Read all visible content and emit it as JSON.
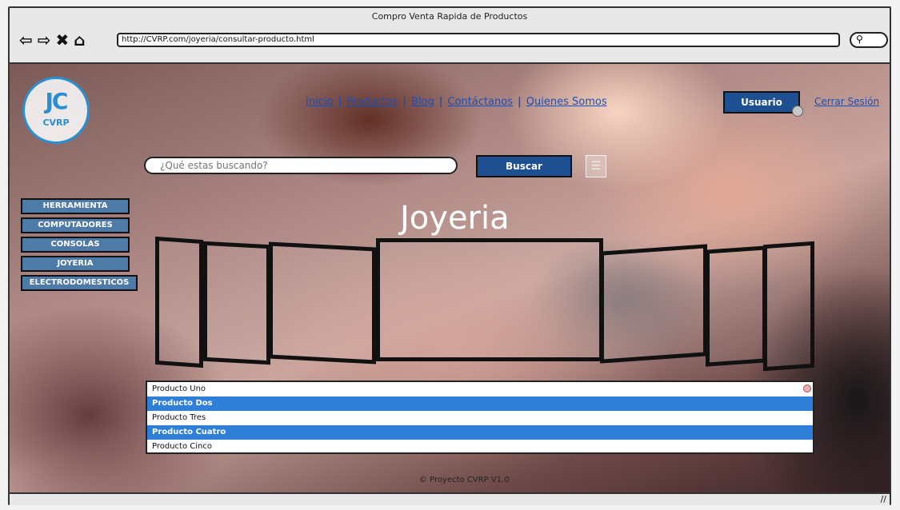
{
  "window": {
    "title": "Compro Venta Rapida de Productos"
  },
  "browser": {
    "url": "http://CVRP.com/joyeria/consultar-producto.html",
    "search_pill_icon": "search-icon"
  },
  "logo": {
    "mark": "JC",
    "text": "CVRP"
  },
  "topnav": {
    "items": [
      "Inicio",
      "Productos",
      "Blog",
      "Contáctanos",
      "Quienes Somos"
    ],
    "user_label": "Usuario",
    "logout_label": "Cerrar Sesión"
  },
  "search": {
    "placeholder": "¿Qué estas buscando?",
    "button_label": "Buscar"
  },
  "sidebar": {
    "items": [
      "HERRAMIENTA",
      "COMPUTADORES",
      "CONSOLAS",
      "JOYERIA",
      "ELECTRODOMESTICOS"
    ]
  },
  "page": {
    "title": "Joyeria"
  },
  "product_list": {
    "items": [
      {
        "label": "Producto Uno",
        "selected": false
      },
      {
        "label": "Producto Dos",
        "selected": true
      },
      {
        "label": "Producto Tres",
        "selected": false
      },
      {
        "label": "Producto Cuatro",
        "selected": true
      },
      {
        "label": "Producto Cinco",
        "selected": false
      }
    ]
  },
  "footer": {
    "text": "© Proyecto CVRP V1.0"
  },
  "colors": {
    "accent": "#1d4f91",
    "link": "#1b4fb8",
    "selection": "#2f7fd8",
    "logo": "#2a8fd0"
  }
}
